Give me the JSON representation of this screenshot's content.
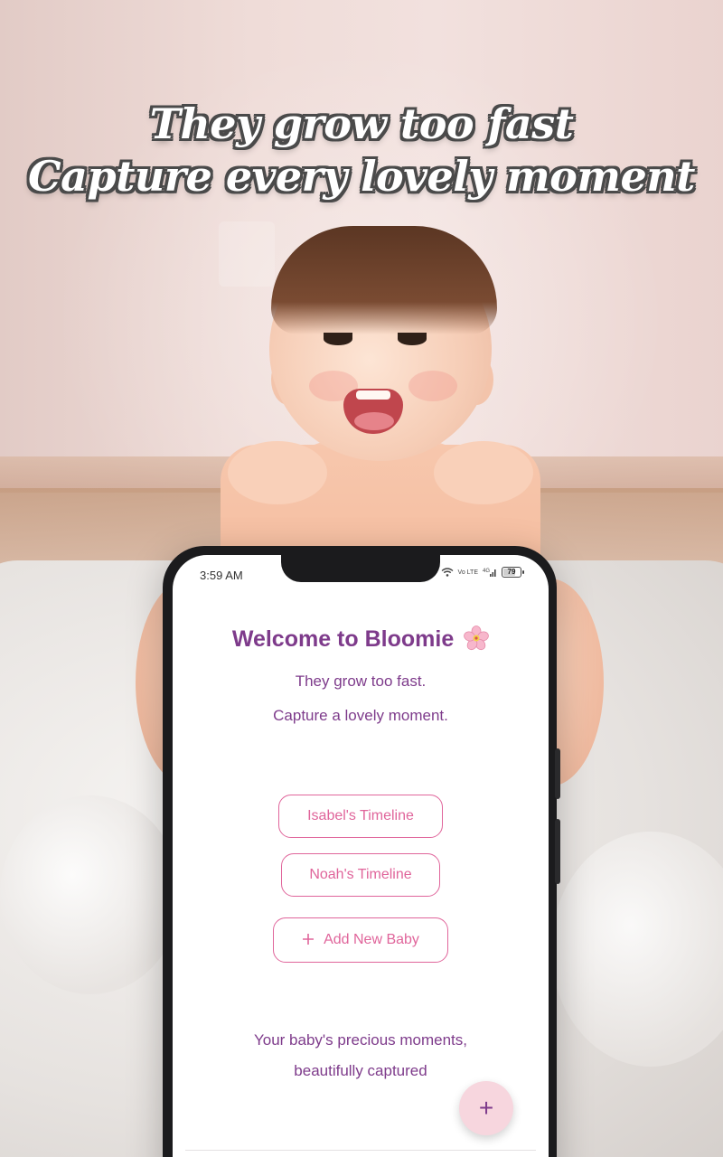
{
  "headline": {
    "line1": "They grow too fast",
    "line2": "Capture every lovely moment"
  },
  "status_bar": {
    "time": "3:59 AM",
    "network": "Vo LTE",
    "signal": "4G",
    "battery": "79"
  },
  "welcome": {
    "title": "Welcome to Bloomie",
    "title_icon": "cherry-blossom-icon",
    "tagline_1": "They grow too fast.",
    "tagline_2": "Capture a lovely moment."
  },
  "timelines": [
    {
      "label": "Isabel's Timeline"
    },
    {
      "label": "Noah's Timeline"
    }
  ],
  "add_baby": {
    "icon": "plus-icon",
    "label": "Add New Baby"
  },
  "footer": {
    "line_1": "Your baby's precious moments,",
    "line_2": "beautifully captured"
  },
  "fab": {
    "icon": "plus-icon",
    "glyph": "+"
  },
  "colors": {
    "accent_purple": "#7e3b8b",
    "accent_pink": "#e0659b",
    "fab_background": "#f7d6de"
  }
}
